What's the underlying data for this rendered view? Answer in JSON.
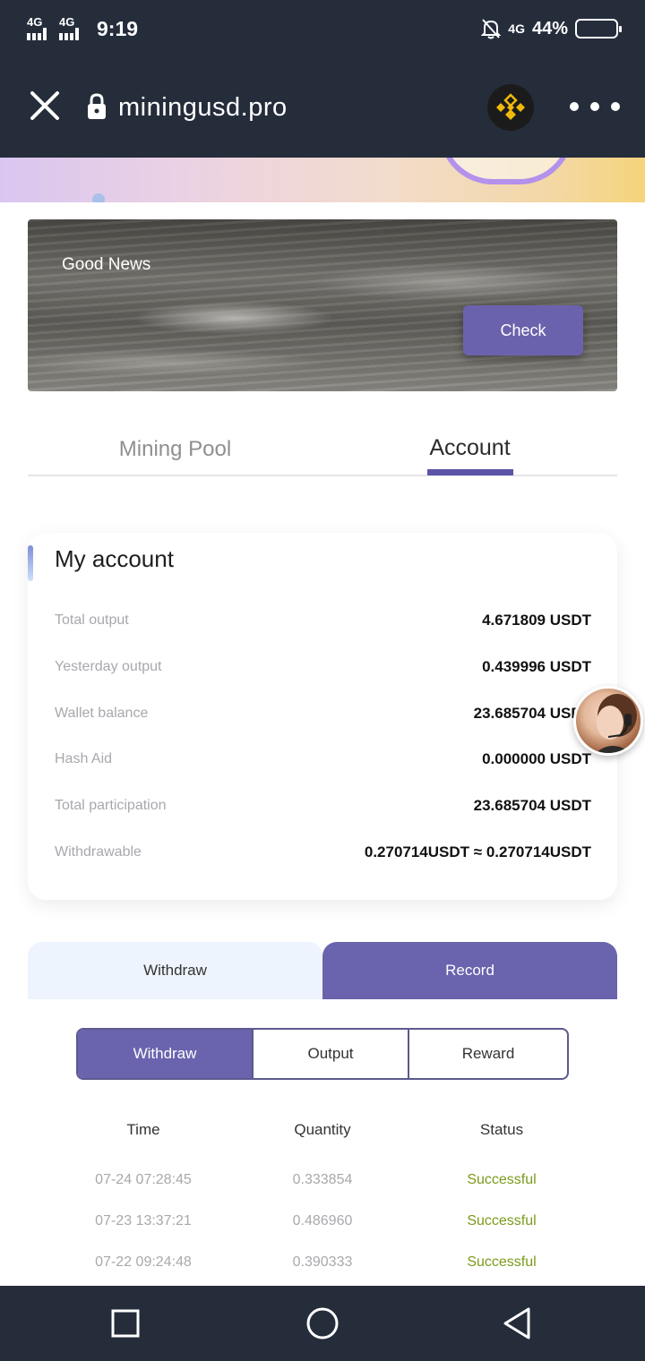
{
  "status_bar": {
    "net1": "4G",
    "net2": "4G",
    "time": "9:19",
    "net3": "4G",
    "battery_pct": "44%",
    "battery_level": 0.44
  },
  "browser": {
    "url": "miningusd.pro",
    "close_icon": "close-icon",
    "lock_icon": "lock-icon",
    "more_icon": "more-dots-icon"
  },
  "banner": {
    "title": "Good News",
    "button": "Check"
  },
  "main_tabs": [
    {
      "label": "Mining Pool",
      "active": false
    },
    {
      "label": "Account",
      "active": true
    }
  ],
  "account": {
    "title": "My account",
    "rows": [
      {
        "label": "Total output",
        "value": "4.671809 USDT"
      },
      {
        "label": "Yesterday output",
        "value": "0.439996 USDT"
      },
      {
        "label": "Wallet balance",
        "value": "23.685704 USDT"
      },
      {
        "label": "Hash Aid",
        "value": "0.000000 USDT"
      },
      {
        "label": "Total participation",
        "value": "23.685704 USDT"
      },
      {
        "label": "Withdrawable",
        "value": "0.270714USDT ≈ 0.270714USDT"
      }
    ]
  },
  "record_tabs": [
    {
      "label": "Withdraw",
      "active": false
    },
    {
      "label": "Record",
      "active": true
    }
  ],
  "sub_tabs": [
    {
      "label": "Withdraw",
      "active": true
    },
    {
      "label": "Output",
      "active": false
    },
    {
      "label": "Reward",
      "active": false
    }
  ],
  "table": {
    "headers": [
      "Time",
      "Quantity",
      "Status"
    ],
    "rows": [
      {
        "time": "07-24 07:28:45",
        "quantity": "0.333854",
        "status": "Successful"
      },
      {
        "time": "07-23 13:37:21",
        "quantity": "0.486960",
        "status": "Successful"
      },
      {
        "time": "07-22 09:24:48",
        "quantity": "0.390333",
        "status": "Successful"
      }
    ]
  },
  "colors": {
    "accent": "#6a63ae",
    "dark_bar": "#252d3b",
    "success": "#7a9a1a"
  }
}
